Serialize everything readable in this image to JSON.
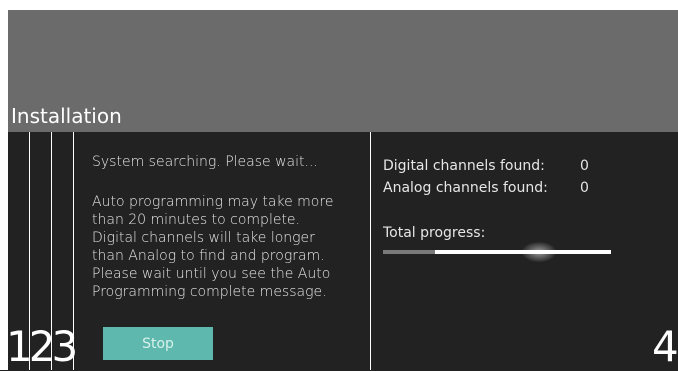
{
  "header": {
    "title": "Installation"
  },
  "left_panel": {
    "status_line": "System searching. Please wait...",
    "info_lines": [
      "Auto programming may take more",
      "than 20 minutes to complete.",
      "Digital channels will take longer",
      "than Analog to find and program.",
      "Please wait until you see the Auto",
      "Programming complete message."
    ],
    "stop_label": "Stop"
  },
  "right_panel": {
    "digital_label": "Digital channels found:",
    "digital_value": "0",
    "analog_label": "Analog channels found:",
    "analog_value": "0",
    "progress_label": "Total progress:",
    "progress_fraction": 0.23
  },
  "step_numbers": {
    "left": "123",
    "right": "4"
  },
  "colors": {
    "header_bg": "#6b6b6b",
    "body_bg": "#222222",
    "button_bg": "#5fb8ad",
    "progress_track": "#ffffff",
    "progress_fill": "#7a7a7a"
  }
}
